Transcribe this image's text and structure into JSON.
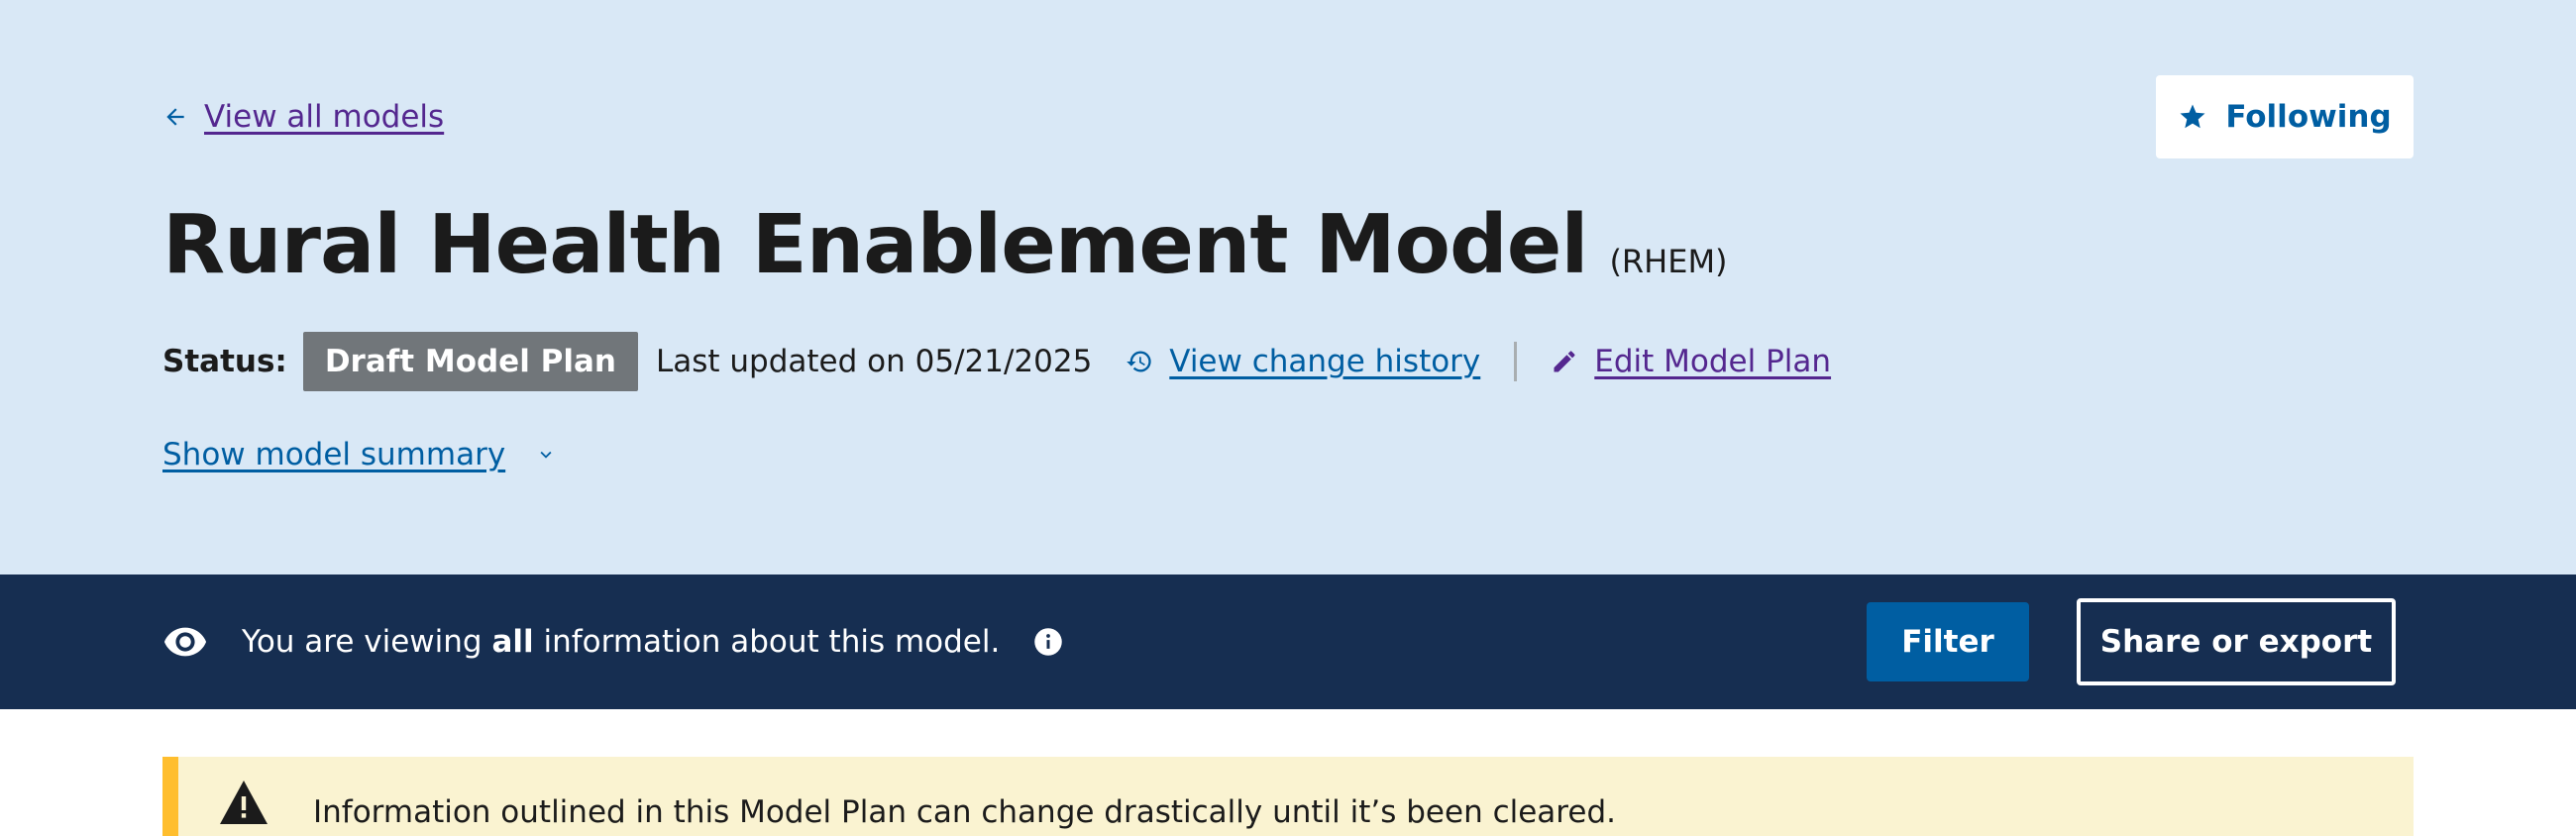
{
  "header": {
    "back_link": "View all models",
    "follow_button": "Following",
    "title": "Rural Health Enablement Model",
    "abbreviation": "(RHEM)",
    "status_label": "Status:",
    "status_tag": "Draft Model Plan",
    "last_updated": "Last updated on 05/21/2025",
    "change_history_link": "View change history",
    "edit_link": "Edit Model Plan",
    "summary_toggle": "Show model summary"
  },
  "filter_bar": {
    "viewing_prefix": "You are viewing ",
    "viewing_bold": "all",
    "viewing_suffix": " information about this model.",
    "filter_button": "Filter",
    "share_button": "Share or export"
  },
  "alert": {
    "text": "Information outlined in this Model Plan can change drastically until it’s been cleared."
  },
  "colors": {
    "hero_bg": "#d9e8f6",
    "filter_bar_bg": "#162e51",
    "primary": "#005ea2",
    "visited_link": "#54278f",
    "status_tag_bg": "#71767a",
    "alert_bg": "#faf3d1",
    "alert_border": "#ffbe2e"
  },
  "icons": {
    "back": "arrow-left-icon",
    "follow": "star-icon",
    "history": "history-icon",
    "edit": "pencil-icon",
    "toggle": "chevron-down-icon",
    "viewing": "eye-icon",
    "info": "info-icon",
    "alert": "warning-icon"
  }
}
